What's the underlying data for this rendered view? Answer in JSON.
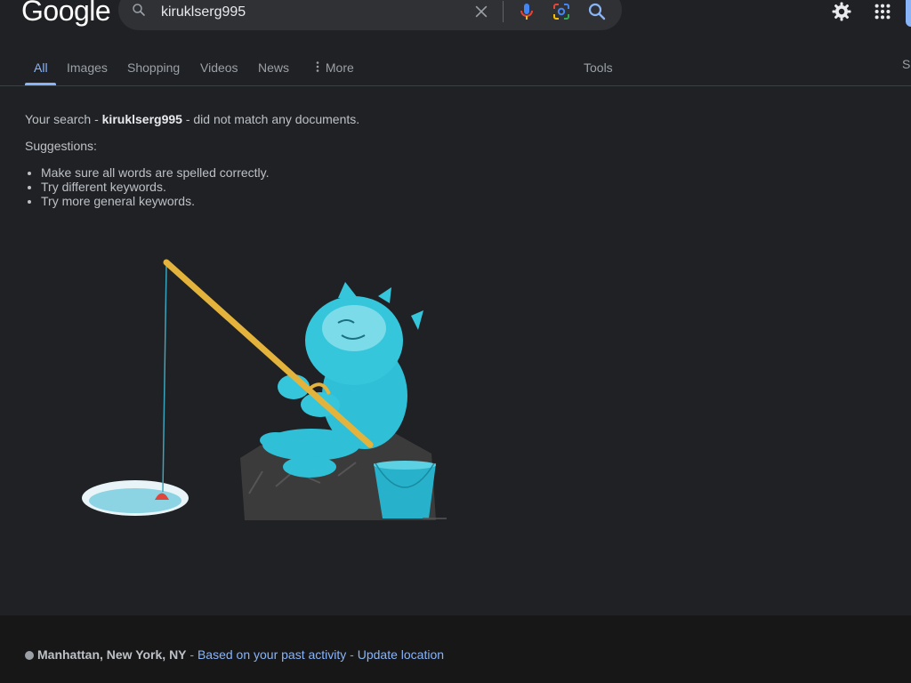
{
  "header": {
    "logo": "Google",
    "search_query": "kiruklserg995"
  },
  "tabs": [
    {
      "label": "All"
    },
    {
      "label": "Images"
    },
    {
      "label": "Shopping"
    },
    {
      "label": "Videos"
    },
    {
      "label": "News"
    },
    {
      "label": "More"
    }
  ],
  "tools_label": "Tools",
  "edge_label": "Sa",
  "results": {
    "message_prefix": "Your search - ",
    "query_bold": "kiruklserg995",
    "message_suffix": " - did not match any documents.",
    "suggestions_title": "Suggestions:",
    "suggestions": [
      "Make sure all words are spelled correctly.",
      "Try different keywords.",
      "Try more general keywords."
    ]
  },
  "footer": {
    "location": "Manhattan, New York, NY",
    "separator": " - ",
    "past_activity_link": "Based on your past activity",
    "update_location_link": "Update location"
  },
  "colors": {
    "background": "#202124",
    "accent": "#8ab4f8",
    "footer_background": "#171717"
  }
}
